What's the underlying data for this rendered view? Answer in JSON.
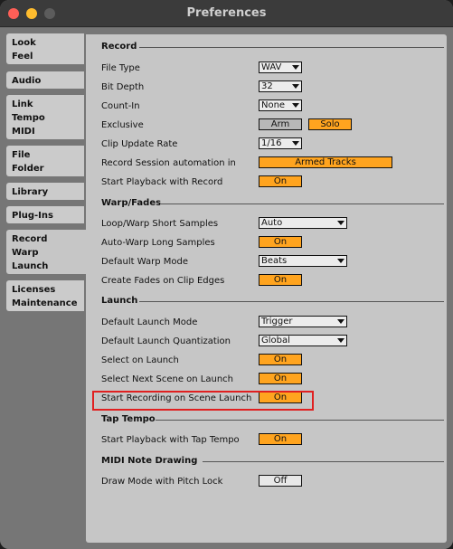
{
  "window": {
    "title": "Preferences"
  },
  "sidebar": [
    {
      "lines": [
        "Look",
        "Feel"
      ]
    },
    {
      "lines": [
        "Audio"
      ]
    },
    {
      "lines": [
        "Link",
        "Tempo",
        "MIDI"
      ]
    },
    {
      "lines": [
        "File",
        "Folder"
      ]
    },
    {
      "lines": [
        "Library"
      ]
    },
    {
      "lines": [
        "Plug-Ins"
      ]
    },
    {
      "lines": [
        "Record",
        "Warp",
        "Launch"
      ]
    },
    {
      "lines": [
        "Licenses",
        "Maintenance"
      ]
    }
  ],
  "sections": {
    "record": "Record",
    "warp": "Warp/Fades",
    "launch": "Launch",
    "tap": "Tap Tempo",
    "midi": "MIDI Note Drawing"
  },
  "record": {
    "file_type": {
      "label": "File Type",
      "value": "WAV"
    },
    "bit_depth": {
      "label": "Bit Depth",
      "value": "32"
    },
    "count_in": {
      "label": "Count-In",
      "value": "None"
    },
    "exclusive": {
      "label": "Exclusive",
      "arm": "Arm",
      "solo": "Solo"
    },
    "clip_update": {
      "label": "Clip Update Rate",
      "value": "1/16"
    },
    "session_auto": {
      "label": "Record Session automation in",
      "value": "Armed Tracks"
    },
    "start_playback": {
      "label": "Start Playback with Record",
      "value": "On"
    }
  },
  "warp": {
    "loop_warp": {
      "label": "Loop/Warp Short Samples",
      "value": "Auto"
    },
    "auto_warp": {
      "label": "Auto-Warp Long Samples",
      "value": "On"
    },
    "default_mode": {
      "label": "Default Warp Mode",
      "value": "Beats"
    },
    "create_fades": {
      "label": "Create Fades on Clip Edges",
      "value": "On"
    }
  },
  "launch": {
    "default_launch_mode": {
      "label": "Default Launch Mode",
      "value": "Trigger"
    },
    "default_quant": {
      "label": "Default Launch Quantization",
      "value": "Global"
    },
    "select_on_launch": {
      "label": "Select on Launch",
      "value": "On"
    },
    "select_next_scene": {
      "label": "Select Next Scene on Launch",
      "value": "On"
    },
    "start_rec_scene": {
      "label": "Start Recording on Scene Launch",
      "value": "On"
    }
  },
  "tap": {
    "start_playback_tap": {
      "label": "Start Playback with Tap Tempo",
      "value": "On"
    }
  },
  "midi": {
    "pitch_lock": {
      "label": "Draw Mode with Pitch Lock",
      "value": "Off"
    }
  },
  "colors": {
    "accent": "#ffa41f",
    "highlight": "#e02020",
    "panel": "#c6c6c6"
  }
}
